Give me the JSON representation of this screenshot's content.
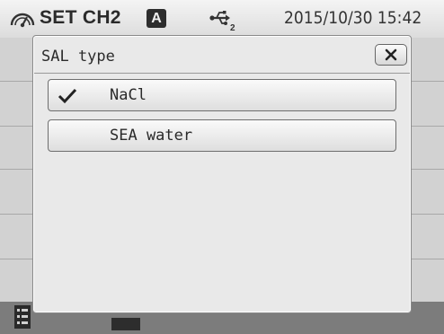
{
  "status_bar": {
    "title": "SET CH2",
    "mode_badge": "A",
    "datetime": "2015/10/30 15:42",
    "icons": [
      "gauge-icon",
      "usb-icon"
    ]
  },
  "dialog": {
    "title": "SAL type",
    "close_icon": "close-icon",
    "options": [
      {
        "label": "NaCl",
        "selected": true
      },
      {
        "label": "SEA water",
        "selected": false
      }
    ]
  },
  "bottom_bar": {
    "icons": [
      "list-icon",
      "book-icon"
    ]
  },
  "colors": {
    "dialog_bg": "#e9e9e9",
    "status_bar_bg": "#e8e8e8",
    "badge_bg": "#2d2d2d"
  }
}
